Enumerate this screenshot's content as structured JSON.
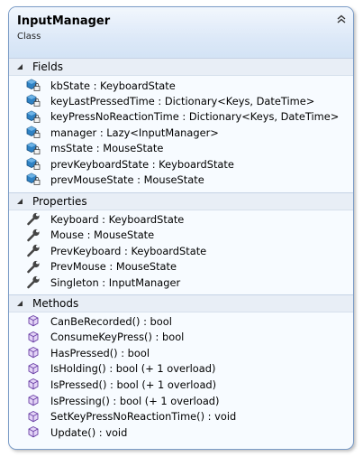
{
  "class": {
    "name": "InputManager",
    "kind": "Class"
  },
  "sections": {
    "fields": {
      "title": "Fields",
      "items": [
        "kbState : KeyboardState",
        "keyLastPressedTime : Dictionary<Keys, DateTime>",
        "keyPressNoReactionTime : Dictionary<Keys, DateTime>",
        "manager : Lazy<InputManager>",
        "msState : MouseState",
        "prevKeyboardState : KeyboardState",
        "prevMouseState : MouseState"
      ]
    },
    "properties": {
      "title": "Properties",
      "items": [
        "Keyboard : KeyboardState",
        "Mouse : MouseState",
        "PrevKeyboard : KeyboardState",
        "PrevMouse : MouseState",
        "Singleton : InputManager"
      ]
    },
    "methods": {
      "title": "Methods",
      "items": [
        "CanBeRecorded() : bool",
        "ConsumeKeyPress() : bool",
        "HasPressed() : bool",
        "IsHolding() : bool (+ 1 overload)",
        "IsPressed() : bool (+ 1 overload)",
        "IsPressing() : bool (+ 1 overload)",
        "SetKeyPressNoReactionTime() : void",
        "Update() : void"
      ]
    }
  },
  "icons": {
    "collapse": "double-chevron-up-icon",
    "section_toggle": "expanded-triangle-icon",
    "field": "private-field-icon",
    "property": "wrench-property-icon",
    "method": "method-cube-icon"
  },
  "colors": {
    "border": "#7b9cc7",
    "header_bg": "#dde9f8",
    "section_header_bg": "#e8eef6",
    "body_bg": "#f7fbff",
    "field_icon": "#1f6fb0",
    "method_icon": "#7a4fb5"
  }
}
